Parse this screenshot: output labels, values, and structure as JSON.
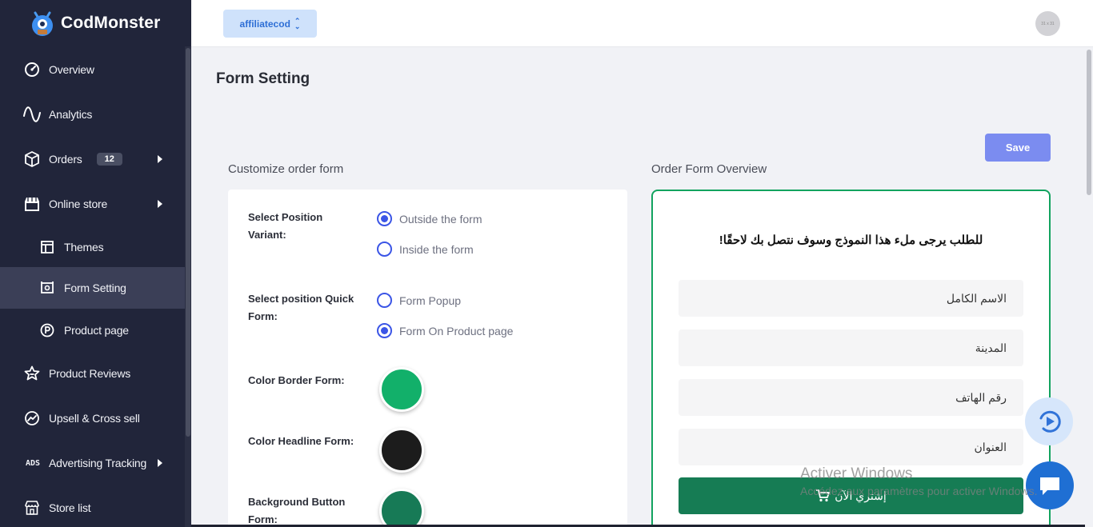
{
  "app": {
    "brand": "CodMonster"
  },
  "sidebar": {
    "items": [
      {
        "label": "Overview",
        "icon": "gauge-icon"
      },
      {
        "label": "Analytics",
        "icon": "wave-icon"
      },
      {
        "label": "Orders",
        "icon": "box-icon",
        "badge": "12"
      },
      {
        "label": "Online store",
        "icon": "storefront-icon"
      },
      {
        "label": "Themes",
        "icon": "layout-icon"
      },
      {
        "label": "Form Setting",
        "icon": "form-gear-icon"
      },
      {
        "label": "Product page",
        "icon": "p-circle-icon"
      },
      {
        "label": "Product Reviews",
        "icon": "star-icon"
      },
      {
        "label": "Upsell & Cross sell",
        "icon": "trend-icon"
      },
      {
        "label": "Advertising Tracking",
        "icon": "ads-icon",
        "icon_text": "ADS"
      },
      {
        "label": "Store list",
        "icon": "store-icon"
      }
    ]
  },
  "topbar": {
    "store": "affiliatecod",
    "avatar_text": "31 x 31"
  },
  "page": {
    "title": "Form Setting",
    "save_label": "Save",
    "left_section": "Customize order form",
    "right_section": "Order Form Overview"
  },
  "settings": {
    "position_variant_label": "Select Position Variant:",
    "position_variant_options": [
      "Outside the form",
      "Inside the form"
    ],
    "quick_form_label": "Select position Quick Form:",
    "quick_form_options": [
      "Form Popup",
      "Form On Product page"
    ],
    "color_border_label": "Color Border Form:",
    "color_headline_label": "Color Headline Form:",
    "bg_button_label": "Background Button Form:",
    "colors": {
      "border": "#12b06a",
      "headline": "#1c1c1c",
      "button_bg": "#177a56"
    }
  },
  "preview": {
    "headline": "للطلب يرجى ملء هذا النموذج وسوف نتصل بك لاحقًا!",
    "fields": [
      "الاسم الكامل",
      "المدينة",
      "رقم الهاتف",
      "العنوان"
    ],
    "buy_label": "إشتري الآن"
  },
  "watermark": {
    "line1": "Activer Windows",
    "line2": "Accédez aux paramètres pour activer Windows."
  }
}
